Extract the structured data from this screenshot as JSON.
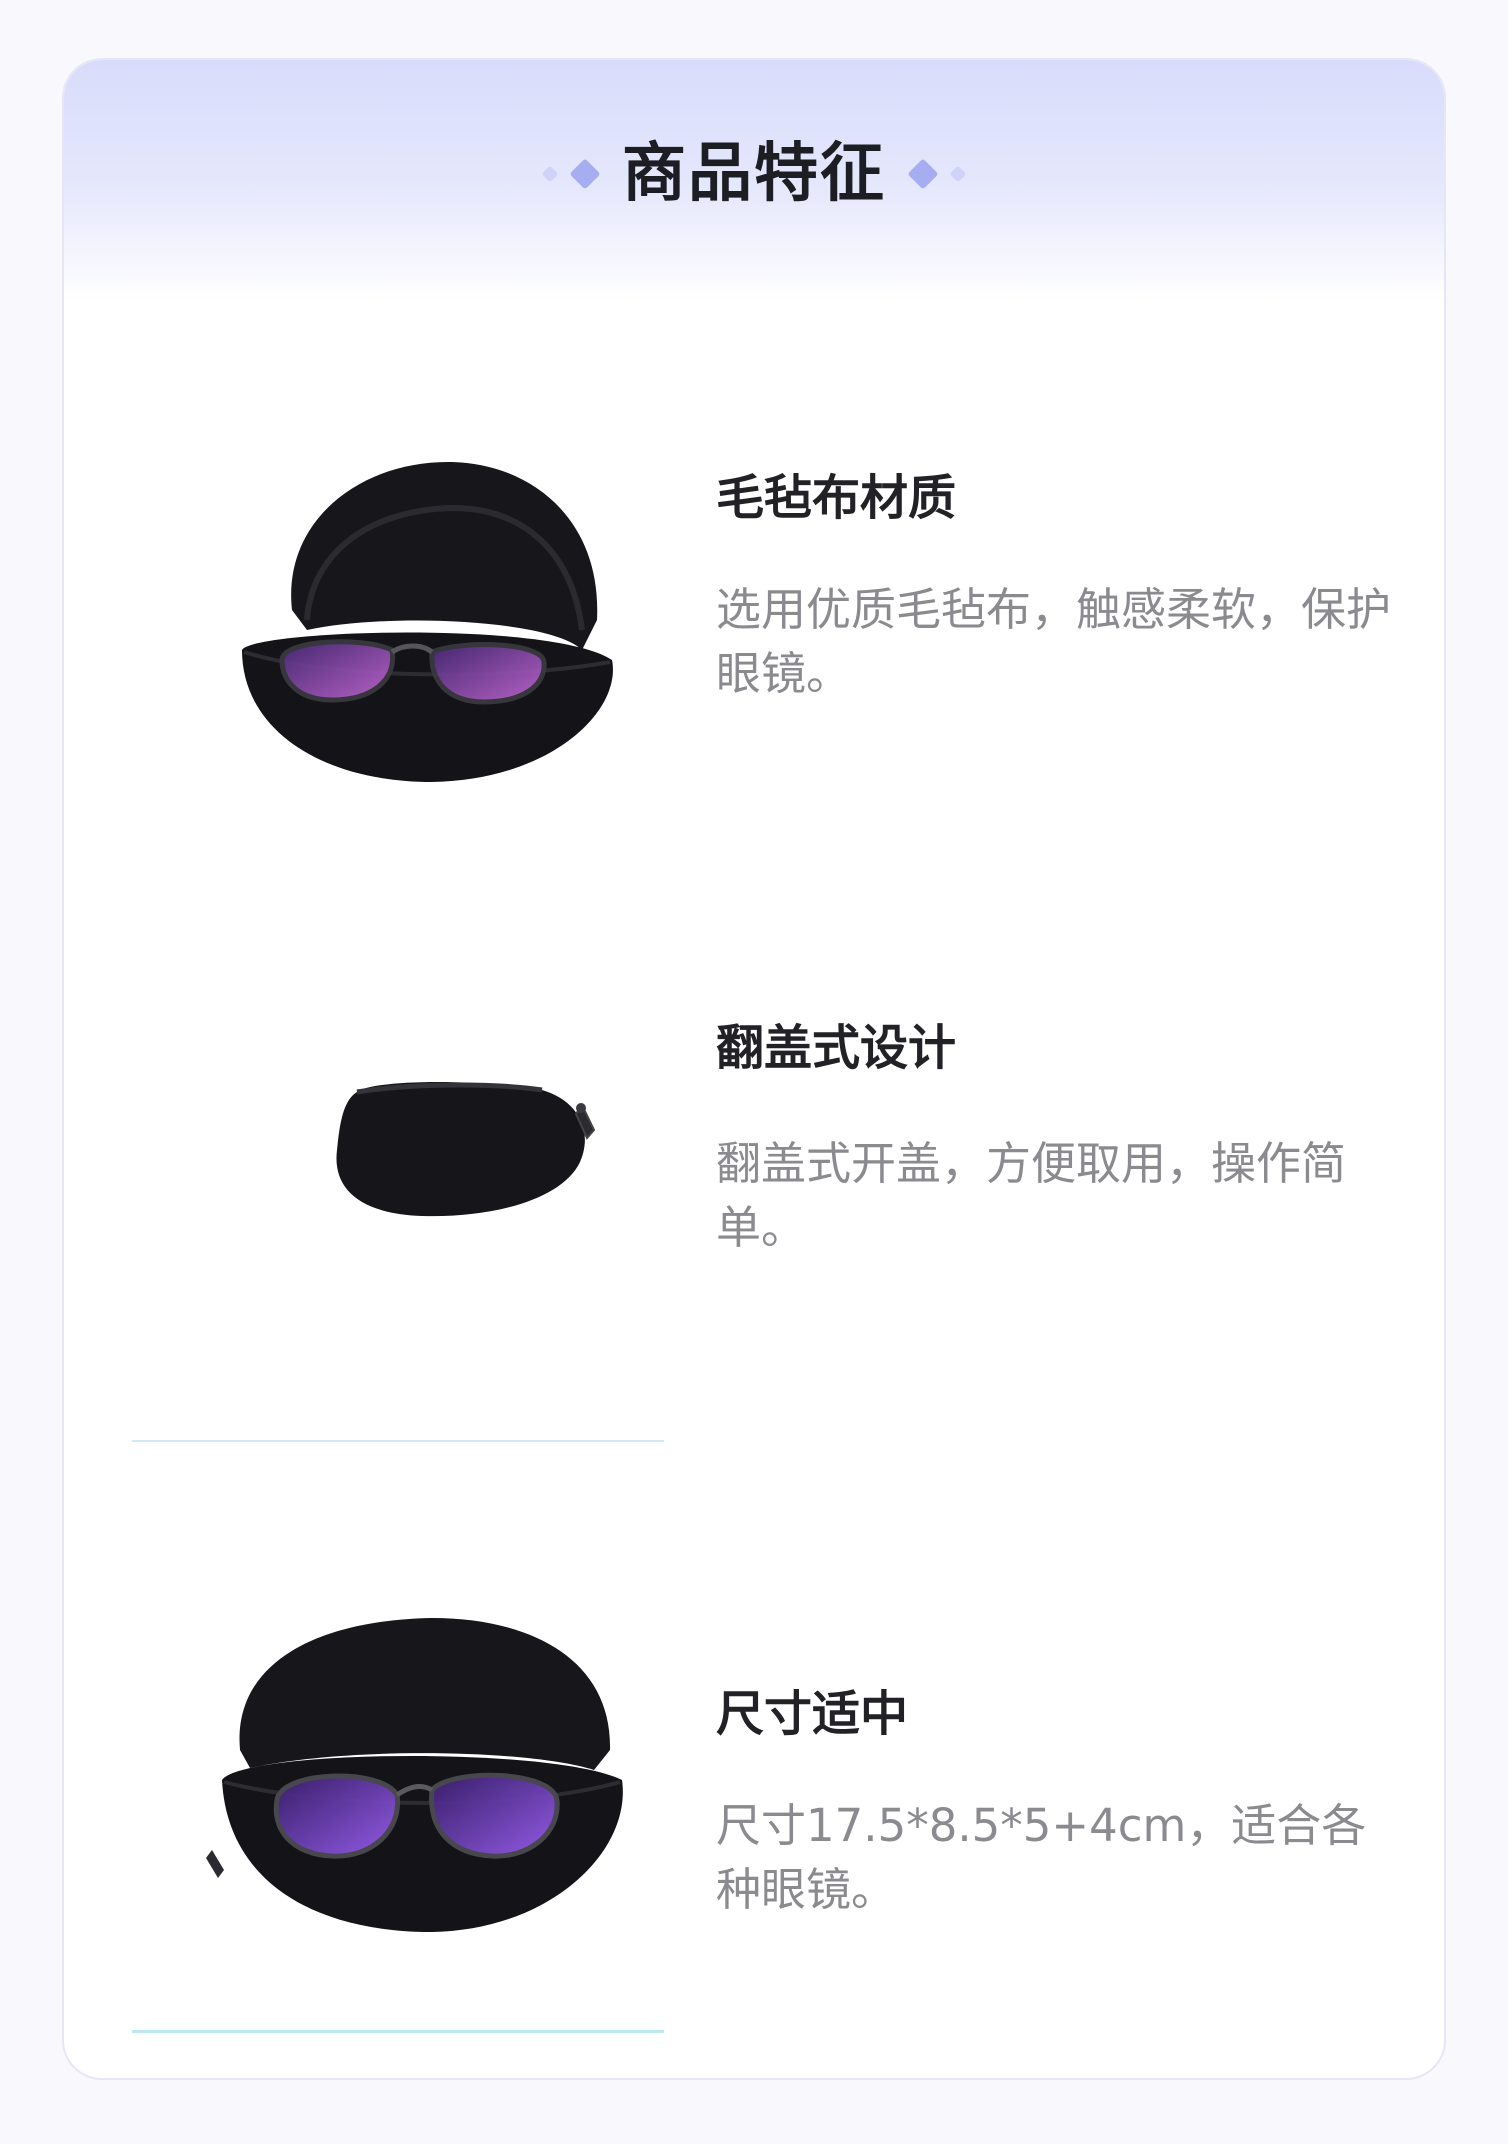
{
  "header": {
    "title": "商品特征"
  },
  "features": [
    {
      "title": "毛毡布材质",
      "description": "选用优质毛毡布，触感柔软，保护眼镜。",
      "image_icon": "open-glasses-case-with-glasses"
    },
    {
      "title": "翻盖式设计",
      "description": "翻盖式开盖，方便取用，操作简单。",
      "image_icon": "closed-zipper-glasses-case"
    },
    {
      "title": "尺寸适中",
      "description": "尺寸17.5*8.5*5+4cm，适合各种眼镜。",
      "image_icon": "open-glasses-case-with-purple-lens-glasses"
    }
  ],
  "colors": {
    "page_background": "#f8f8fd",
    "header_gradient_top": "#d8dcfb",
    "diamond_accent": "#a7adf1",
    "title_text": "#1d1d24",
    "description_text": "#8a8a8f",
    "case_black": "#16161a",
    "lens_purple": "#7b4fd6"
  }
}
